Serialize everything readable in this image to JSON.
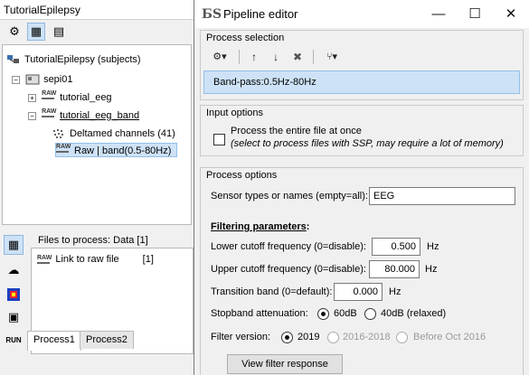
{
  "main_window": {
    "title": "TutorialEpilepsy",
    "tree": {
      "root_label": "TutorialEpilepsy (subjects)",
      "subject_label": "sepi01",
      "folder1_label": "tutorial_eeg",
      "folder2_label": "tutorial_eeg_band",
      "file1_label": "Deltamed channels (41)",
      "file2_label": "Raw | band(0.5-80Hz)",
      "expand_glyph": "+",
      "collapse_glyph": "−",
      "raw_icon_text": "RAW"
    },
    "files_panel": {
      "label": "Files to process: Data [1]",
      "item_label": "Link to raw file",
      "item_count": "[1]"
    },
    "tabs": [
      "Process1",
      "Process2"
    ],
    "side_icons": [
      "data-icon",
      "brain-icon",
      "cortex-icon",
      "sources-icon",
      "run-icon"
    ],
    "run_label": "RUN"
  },
  "dialog": {
    "logo_text": "БS",
    "title": "Pipeline editor",
    "minimize_glyph": "—",
    "maximize_glyph": "☐",
    "close_glyph": "✕",
    "process_selection": {
      "label": "Process selection",
      "toolbar": {
        "settings_glyph": "⚙▾",
        "up_glyph": "↑",
        "down_glyph": "↓",
        "delete_glyph": "✖",
        "pipeline_glyph": "⑂▾"
      },
      "selected_process": "Band-pass:0.5Hz-80Hz"
    },
    "input_options": {
      "label": "Input options",
      "checkbox_label": "Process the entire file at once",
      "checkbox_hint": "(select to process files with SSP, may require a lot of memory)",
      "checked": false
    },
    "process_options": {
      "label": "Process options",
      "sensor_label": "Sensor types or names (empty=all):",
      "sensor_value": "EEG",
      "filtering_title": "Filtering parameters",
      "filtering_colon": ":",
      "lower_label": "Lower cutoff frequency (0=disable):",
      "lower_value": "0.500",
      "lower_unit": "Hz",
      "upper_label": "Upper cutoff frequency (0=disable):",
      "upper_value": "80.000",
      "upper_unit": "Hz",
      "transition_label": "Transition band (0=default):",
      "transition_value": "0.000",
      "transition_unit": "Hz",
      "stopband_label": "Stopband attenuation:",
      "stopband_options": [
        "60dB",
        "40dB (relaxed)"
      ],
      "stopband_selected": "60dB",
      "version_label": "Filter version:",
      "version_options": [
        "2019",
        "2016-2018",
        "Before Oct 2016"
      ],
      "version_selected": "2019",
      "view_button": "View filter response"
    }
  }
}
